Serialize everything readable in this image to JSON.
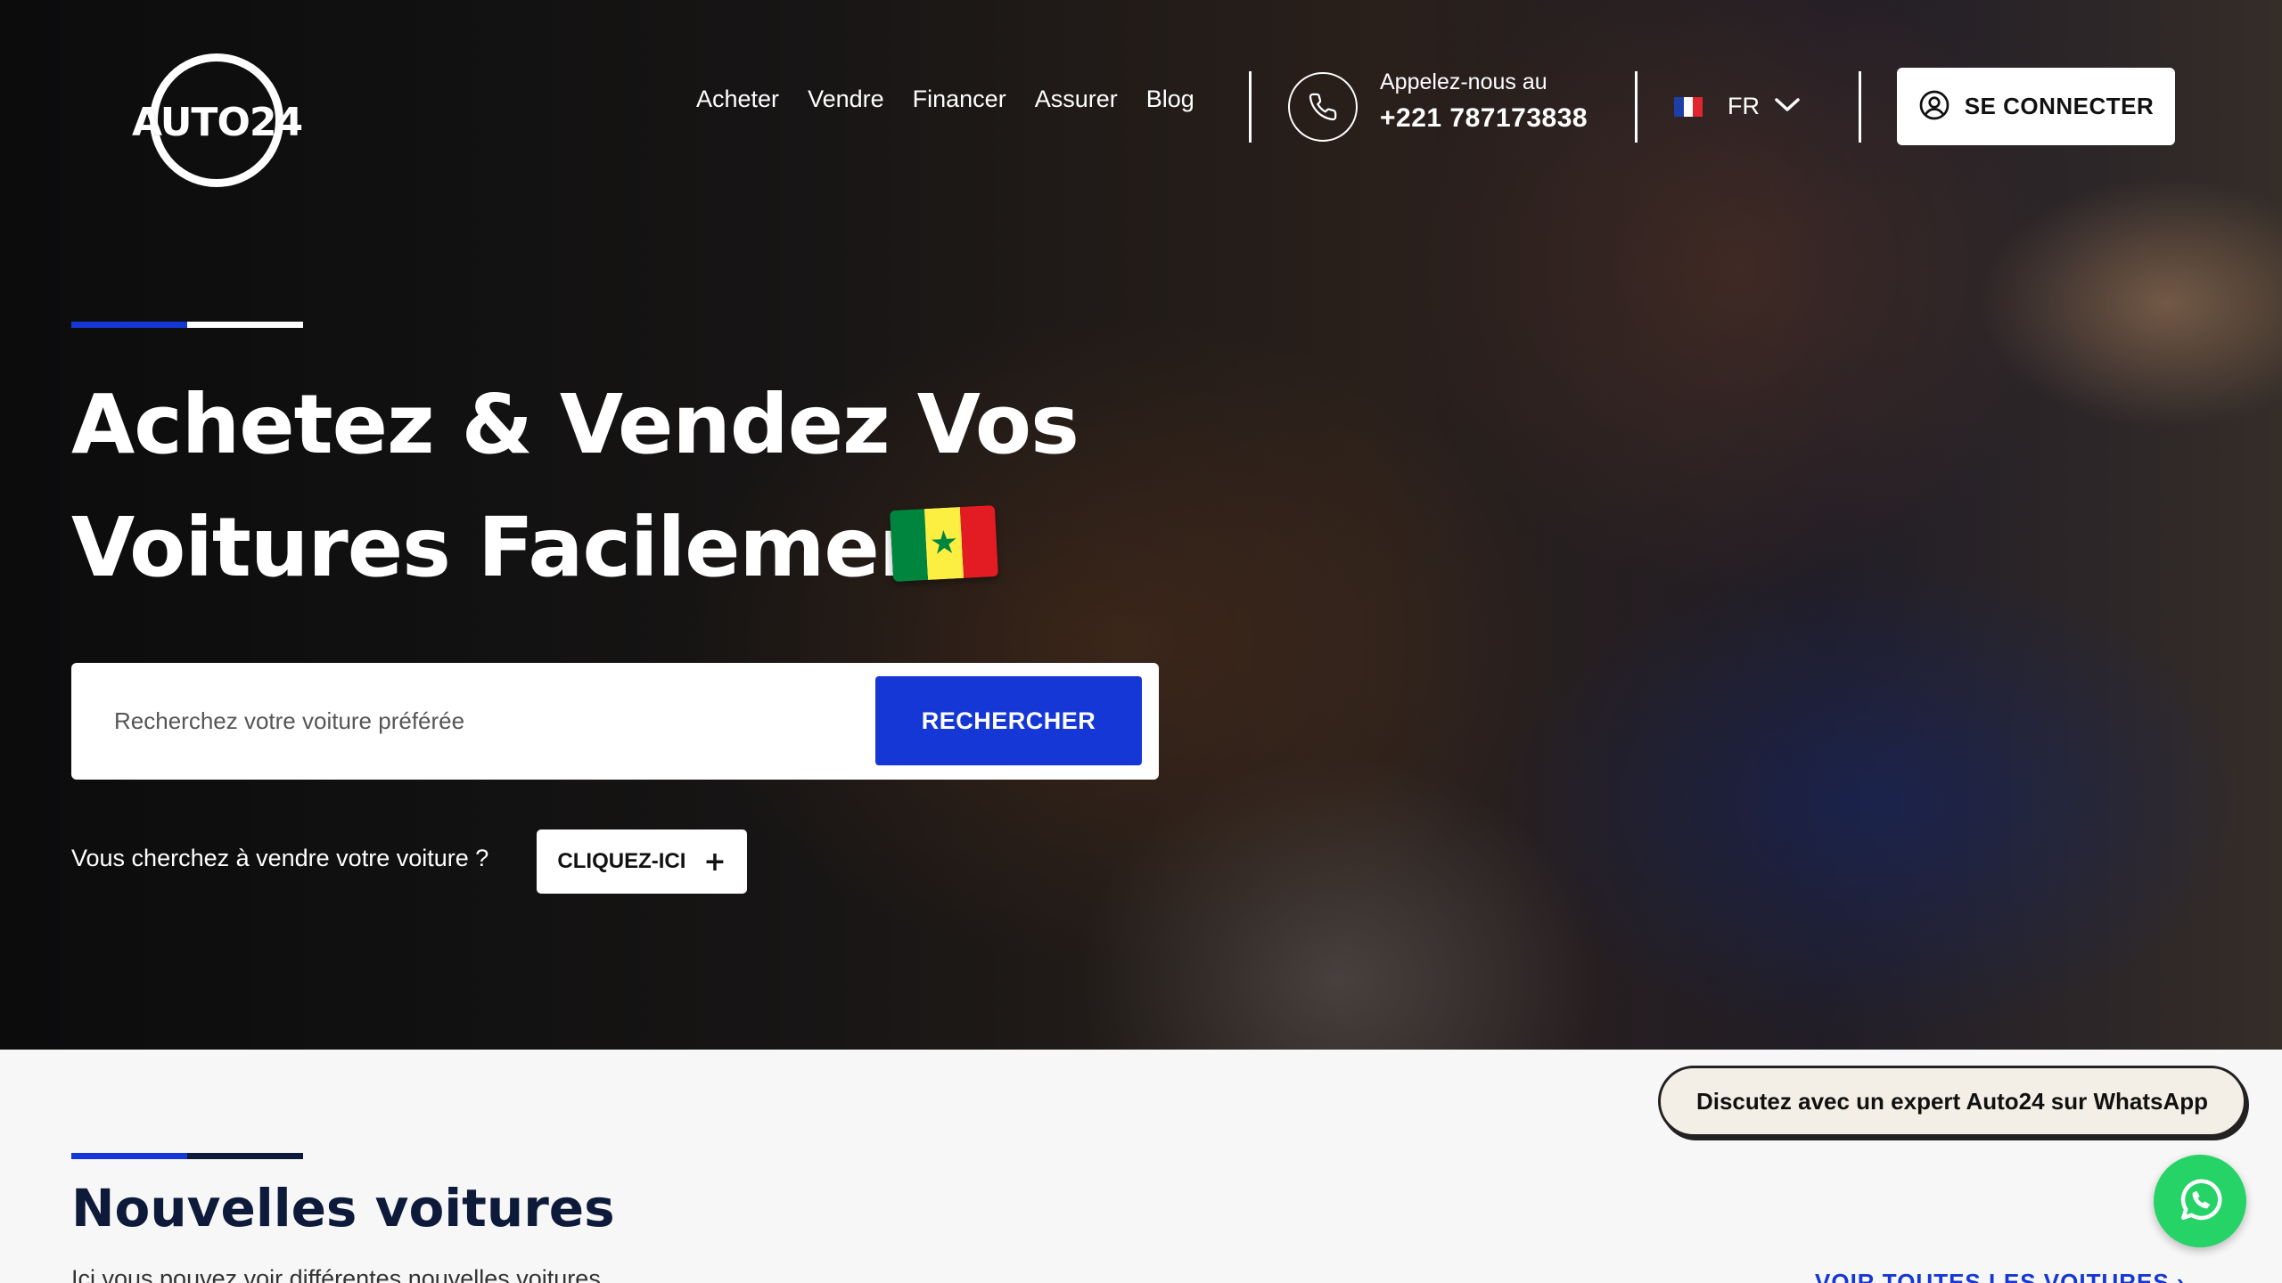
{
  "brand": {
    "logo_text": "AUTO24"
  },
  "nav": {
    "items": [
      {
        "label": "Acheter"
      },
      {
        "label": "Vendre"
      },
      {
        "label": "Financer"
      },
      {
        "label": "Assurer"
      },
      {
        "label": "Blog"
      }
    ]
  },
  "contact": {
    "label": "Appelez-nous au",
    "phone": "+221 787173838",
    "icon": "phone-icon"
  },
  "language": {
    "code": "FR",
    "flag": "france-flag",
    "icon": "chevron-down-icon"
  },
  "login": {
    "label": "SE CONNECTER",
    "icon": "user-circle-icon"
  },
  "hero": {
    "title_line1": "Achetez & Vendez Vos",
    "title_line2": "Voitures Facilement",
    "flag": "senegal-flag",
    "search": {
      "placeholder": "Recherchez votre voiture préférée",
      "button_label": "RECHERCHER"
    },
    "sell": {
      "text": "Vous cherchez à vendre votre voiture ?",
      "button_label": "CLIQUEZ-ICI",
      "button_icon": "plus-icon"
    }
  },
  "new_cars": {
    "title": "Nouvelles voitures",
    "subtitle": "Ici vous pouvez voir différentes nouvelles voitures",
    "see_all_label": "VOIR TOUTES LES VOITURES ›"
  },
  "whatsapp": {
    "chip_label": "Discutez avec un expert Auto24 sur WhatsApp",
    "icon": "whatsapp-icon"
  },
  "colors": {
    "accent_blue": "#1437d6",
    "navy": "#0d1a3a",
    "whatsapp_green": "#25d366"
  }
}
